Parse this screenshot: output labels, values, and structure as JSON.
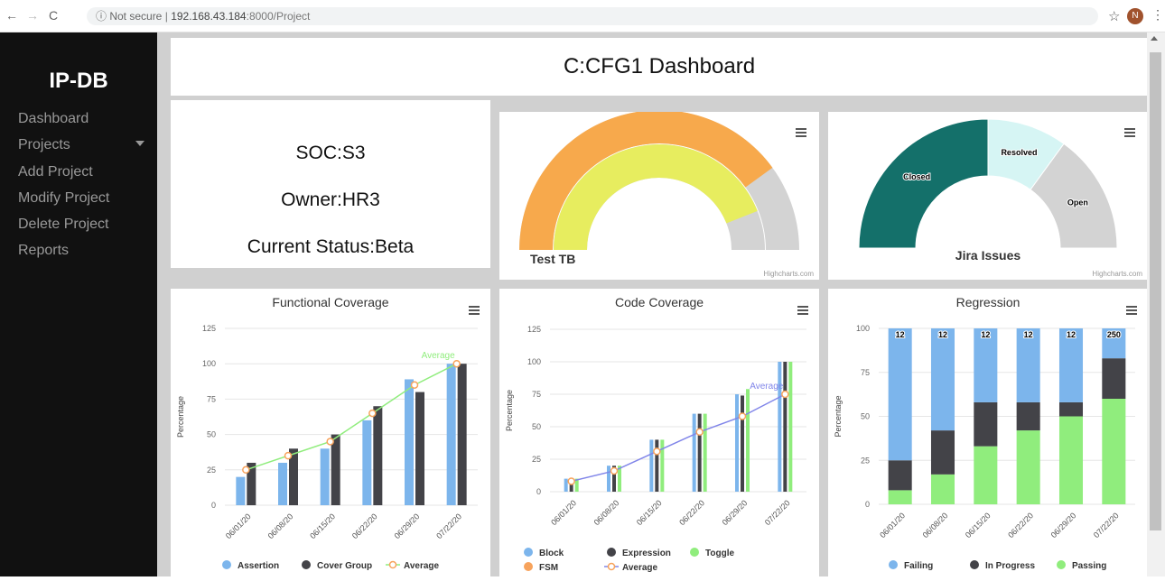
{
  "browser": {
    "back": "←",
    "forward": "→",
    "reload": "C",
    "security": "ⓘ Not secure",
    "separator": "|",
    "host": "192.168.43.184",
    "path": ":8000/Project",
    "star": "☆",
    "avatar_letter": "N",
    "menu": "⋮"
  },
  "sidebar": {
    "brand": "IP-DB",
    "items": [
      {
        "label": "Dashboard"
      },
      {
        "label": "Projects"
      },
      {
        "label": "Add Project"
      },
      {
        "label": "Modify Project"
      },
      {
        "label": "Delete Project"
      },
      {
        "label": "Reports"
      }
    ]
  },
  "header": {
    "title": "C:CFG1 Dashboard"
  },
  "info": {
    "soc": "SOC:S3",
    "owner": "Owner:HR3",
    "status": "Current Status:Beta"
  },
  "credits": "Highcharts.com",
  "colors": {
    "sidebar": "#111111",
    "orange": "#f7a94c",
    "yellow": "#e7ed5f",
    "gauge_track": "#d3d3d3",
    "teal": "#14706a",
    "light_cyan": "#d6f5f4",
    "blue": "#7cb5ec",
    "dark": "#434348",
    "green": "#90ed7d",
    "fsm_orange": "#f7a35c",
    "avg_green": "#90ed7d",
    "avg_blue": "#8085e9"
  },
  "chart_data": [
    {
      "type": "pie",
      "subtype": "activity-gauge",
      "title": "Test TB",
      "series": [
        {
          "color": "#f7a94c",
          "value": 0.8
        },
        {
          "color": "#e7ed5f",
          "value": 0.88
        }
      ]
    },
    {
      "type": "pie",
      "subtype": "semi-donut",
      "title": "Jira Issues",
      "slices": [
        {
          "name": "Closed",
          "value": 0.5,
          "color": "#14706a"
        },
        {
          "name": "Resolved",
          "value": 0.2,
          "color": "#d6f5f4"
        },
        {
          "name": "Open",
          "value": 0.3,
          "color": "#d3d3d3"
        }
      ]
    },
    {
      "type": "bar",
      "title": "Functional Coverage",
      "ylabel": "Percentage",
      "ylim": [
        0,
        125
      ],
      "yticks": [
        0,
        25,
        50,
        75,
        100,
        125
      ],
      "categories": [
        "06/01/20",
        "06/08/20",
        "06/15/20",
        "06/22/20",
        "06/29/20",
        "07/22/20"
      ],
      "series": [
        {
          "name": "Assertion",
          "kind": "column",
          "color": "#7cb5ec",
          "values": [
            20,
            30,
            40,
            60,
            89,
            100
          ]
        },
        {
          "name": "Cover Group",
          "kind": "column",
          "color": "#434348",
          "values": [
            30,
            40,
            50,
            70,
            80,
            100
          ]
        },
        {
          "name": "Average",
          "kind": "line",
          "color": "#90ed7d",
          "marker": "#f7a35c",
          "values": [
            25,
            35,
            45,
            65,
            85,
            100
          ]
        }
      ],
      "annotation": "Average"
    },
    {
      "type": "bar",
      "title": "Code Coverage",
      "ylabel": "Percentage",
      "ylim": [
        0,
        125
      ],
      "yticks": [
        0,
        25,
        50,
        75,
        100,
        125
      ],
      "categories": [
        "06/01/20",
        "06/08/20",
        "06/15/20",
        "06/22/20",
        "06/29/20",
        "07/22/20"
      ],
      "series": [
        {
          "name": "Block",
          "kind": "column",
          "color": "#7cb5ec",
          "values": [
            10,
            20,
            40,
            60,
            75,
            100
          ]
        },
        {
          "name": "Expression",
          "kind": "column",
          "color": "#434348",
          "values": [
            10,
            20,
            40,
            60,
            74,
            100
          ]
        },
        {
          "name": "Toggle",
          "kind": "column",
          "color": "#90ed7d",
          "values": [
            10,
            20,
            40,
            60,
            79,
            100
          ]
        },
        {
          "name": "FSM",
          "kind": "column",
          "color": "#f7a35c",
          "values": [
            0,
            0,
            0,
            0,
            0,
            0
          ]
        },
        {
          "name": "Average",
          "kind": "line",
          "color": "#8085e9",
          "marker": "#f7a35c",
          "values": [
            8,
            16,
            31,
            46,
            58,
            75
          ]
        }
      ],
      "annotation": "Average"
    },
    {
      "type": "bar",
      "subtype": "stacked-percent",
      "title": "Regression",
      "ylabel": "Percentage",
      "ylim": [
        0,
        100
      ],
      "yticks": [
        0,
        25,
        50,
        75,
        100
      ],
      "categories": [
        "06/01/20",
        "06/08/20",
        "06/15/20",
        "06/22/20",
        "06/29/20",
        "07/22/20"
      ],
      "totals": [
        "12",
        "12",
        "12",
        "12",
        "12",
        "250"
      ],
      "series": [
        {
          "name": "Failing",
          "color": "#7cb5ec",
          "values": [
            75,
            58,
            42,
            42,
            42,
            17
          ]
        },
        {
          "name": "In Progress",
          "color": "#434348",
          "values": [
            17,
            25,
            25,
            16,
            8,
            23
          ]
        },
        {
          "name": "Passing",
          "color": "#90ed7d",
          "values": [
            8,
            17,
            33,
            42,
            50,
            60
          ]
        }
      ]
    }
  ]
}
